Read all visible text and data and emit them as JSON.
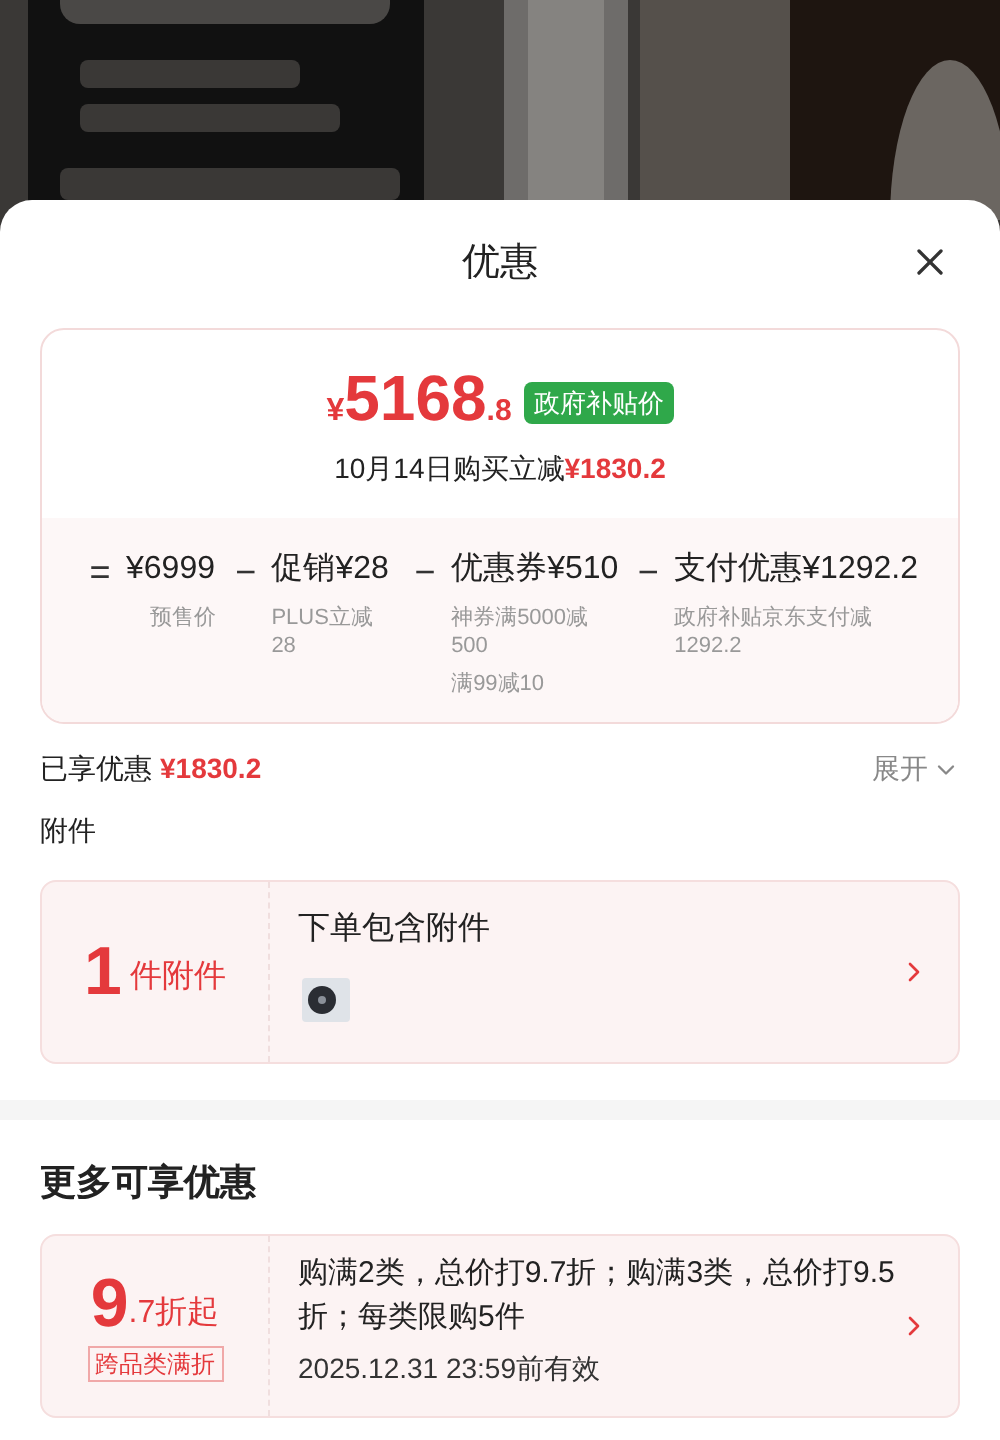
{
  "sheet": {
    "title": "优惠"
  },
  "price_card": {
    "currency": "¥",
    "price_int": "5168",
    "price_dec": ".8",
    "badge": "政府补贴价",
    "summary": "10月14日购买立减**¥1830.2**",
    "breakdown": [
      {
        "op": "=",
        "label": "¥6999",
        "notes": [
          "预售价"
        ]
      },
      {
        "op": "−",
        "label": "促销¥28",
        "notes": [
          "PLUS立减28"
        ]
      },
      {
        "op": "−",
        "label": "优惠券¥510",
        "notes": [
          "神券满5000减500",
          "满99减10"
        ]
      },
      {
        "op": "−",
        "label": "支付优惠¥1292.2",
        "notes": [
          "政府补贴京东支付减1292.2"
        ]
      }
    ]
  },
  "enjoyed": {
    "label": "已享优惠",
    "amount": "¥1830.2",
    "toggle": "展开",
    "expanded": false
  },
  "accessories": {
    "heading": "附件",
    "count": "1",
    "unit": "件附件",
    "title": "下单包含附件"
  },
  "more": {
    "heading": "更多可享优惠",
    "offers": [
      {
        "big": "9",
        "small": ".7折起",
        "tag": "跨品类满折",
        "text": "购满2类，总价打9.7折；购满3类，总价打9.5折；每类限购5件",
        "validity": "2025.12.31 23:59前有效"
      }
    ]
  }
}
